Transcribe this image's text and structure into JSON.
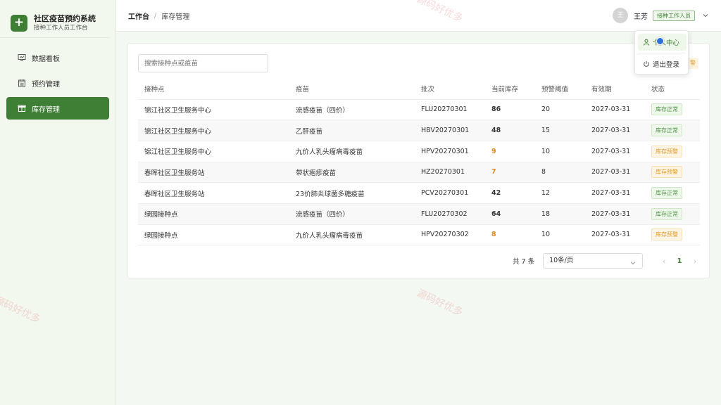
{
  "brand": {
    "title": "社区疫苗预约系统",
    "subtitle": "接种工作人员工作台",
    "logo_icon": "plus-icon"
  },
  "sidebar": {
    "items": [
      {
        "label": "数据看板",
        "icon": "dashboard-icon",
        "active": false
      },
      {
        "label": "预约管理",
        "icon": "calendar-icon",
        "active": false
      },
      {
        "label": "库存管理",
        "icon": "inventory-box-icon",
        "active": true
      }
    ]
  },
  "header": {
    "breadcrumb_root": "工作台",
    "breadcrumb_sep": "/",
    "breadcrumb_current": "库存管理",
    "user": {
      "avatar_text": "王",
      "name": "王芳",
      "role": "接种工作人员"
    }
  },
  "user_menu": {
    "items": [
      "个人中心",
      "退出登录"
    ]
  },
  "search": {
    "placeholder": "搜索接种点或疫苗"
  },
  "alert_badge_text": "警",
  "table": {
    "columns": [
      "接种点",
      "疫苗",
      "批次",
      "当前库存",
      "预警阈值",
      "有效期",
      "状态"
    ],
    "rows": [
      [
        "锦江社区卫生服务中心",
        "流感疫苗（四价）",
        "FLU20270301",
        "86",
        "20",
        "2027-03-31",
        "库存正常"
      ],
      [
        "锦江社区卫生服务中心",
        "乙肝疫苗",
        "HBV20270301",
        "48",
        "15",
        "2027-03-31",
        "库存正常"
      ],
      [
        "锦江社区卫生服务中心",
        "九价人乳头瘤病毒疫苗",
        "HPV20270301",
        "9",
        "10",
        "2027-03-31",
        "库存预警"
      ],
      [
        "春晖社区卫生服务站",
        "带状疱疹疫苗",
        "HZ20270301",
        "7",
        "8",
        "2027-03-31",
        "库存预警"
      ],
      [
        "春晖社区卫生服务站",
        "23价肺炎球菌多糖疫苗",
        "PCV20270301",
        "42",
        "12",
        "2027-03-31",
        "库存正常"
      ],
      [
        "绿园接种点",
        "流感疫苗（四价）",
        "FLU20270302",
        "64",
        "18",
        "2027-03-31",
        "库存正常"
      ],
      [
        "绿园接种点",
        "九价人乳头瘤病毒疫苗",
        "HPV20270302",
        "8",
        "10",
        "2027-03-31",
        "库存预警"
      ]
    ]
  },
  "pagination": {
    "total_text": "共 7 条",
    "page_size": "10条/页",
    "current_page": "1",
    "prev": "‹",
    "next": "›"
  },
  "watermark_text": "源码好优多",
  "colors": {
    "brand_green": "#3f7f35",
    "warn_orange": "#e08a1c",
    "cursor_blue": "#2f6fd8"
  }
}
